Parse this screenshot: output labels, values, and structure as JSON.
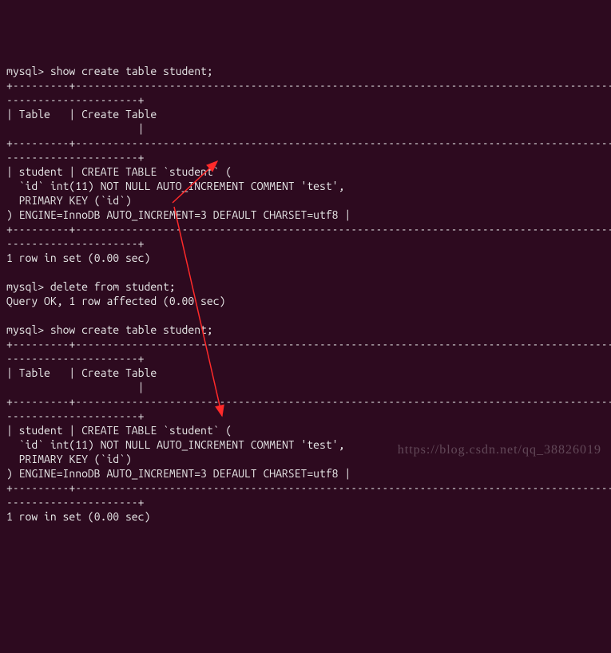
{
  "terminal": {
    "prompt": "mysql>",
    "cmd1": "show create table student;",
    "border_top1": "+---------+-----------------------------------------------------------------------------------------------+",
    "border_cont1": "---------------------+",
    "header_row1": "| Table   | Create Table                                                                                      ",
    "header_cont1": "                     |",
    "body1_l1": "| student | CREATE TABLE `student` (",
    "body1_l2": "  `id` int(11) NOT NULL AUTO_INCREMENT COMMENT 'test',",
    "body1_l3": "  PRIMARY KEY (`id`)",
    "body1_l4": ") ENGINE=InnoDB AUTO_INCREMENT=3 DEFAULT CHARSET=utf8 |",
    "result1": "1 row in set (0.00 sec)",
    "cmd2": "delete from student;",
    "result2": "Query OK, 1 row affected (0.00 sec)",
    "cmd3": "show create table student;",
    "header_row2": "| Table   | Create Table                                                                                      ",
    "header_cont2": "                     |",
    "body2_l1": "| student | CREATE TABLE `student` (",
    "body2_l2": "  `id` int(11) NOT NULL AUTO_INCREMENT COMMENT 'test',",
    "body2_l3": "  PRIMARY KEY (`id`)",
    "body2_l4": ") ENGINE=InnoDB AUTO_INCREMENT=3 DEFAULT CHARSET=utf8 |",
    "result3": "1 row in set (0.00 sec)"
  },
  "watermark": "https://blog.csdn.net/qq_38826019"
}
